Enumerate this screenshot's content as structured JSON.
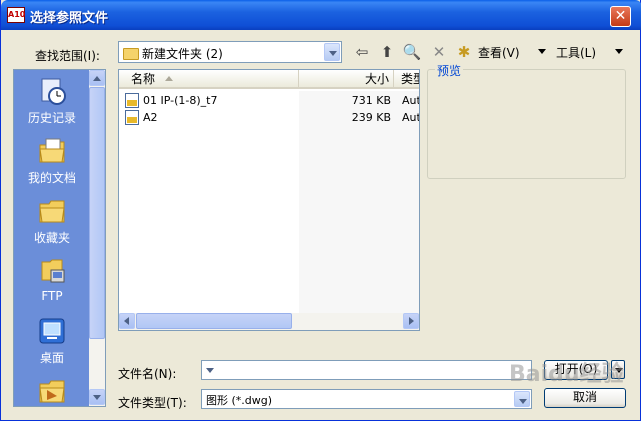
{
  "window": {
    "title": "选择参照文件",
    "close_symbol": "✕",
    "app_icon_text": "A10"
  },
  "lookin": {
    "label": "查找范围(I):",
    "value": "新建文件夹 (2)"
  },
  "toolbar": {
    "back_icon": "⇦",
    "up_icon": "⬆",
    "search_icon": "🔍",
    "delete_icon": "✕",
    "newfolder_icon": "✱",
    "view_label": "查看(V)",
    "tools_label": "工具(L)"
  },
  "places": [
    {
      "label": "历史记录",
      "icon": "history-icon"
    },
    {
      "label": "我的文档",
      "icon": "my-documents-icon"
    },
    {
      "label": "收藏夹",
      "icon": "favorites-icon"
    },
    {
      "label": "FTP",
      "icon": "ftp-icon"
    },
    {
      "label": "桌面",
      "icon": "desktop-icon"
    }
  ],
  "filelist": {
    "columns": {
      "name": "名称",
      "size": "大小",
      "type": "类型"
    },
    "rows": [
      {
        "name": "01 IP-(1-8)_t7",
        "size": "731 KB",
        "type": "Aut"
      },
      {
        "name": "A2",
        "size": "239 KB",
        "type": "Aut"
      }
    ]
  },
  "preview": {
    "label": "预览"
  },
  "filename": {
    "label": "文件名(N):",
    "value": ""
  },
  "filetype": {
    "label": "文件类型(T):",
    "value": "图形 (*.dwg)"
  },
  "buttons": {
    "open": "打开(O)",
    "cancel": "取消"
  },
  "watermark": "Baidu经验",
  "colors": {
    "titlebar": "#0a5fe8",
    "places_bg": "#6b8ed9",
    "dialog_bg": "#ece9d8",
    "preview_label": "#0046d5"
  }
}
